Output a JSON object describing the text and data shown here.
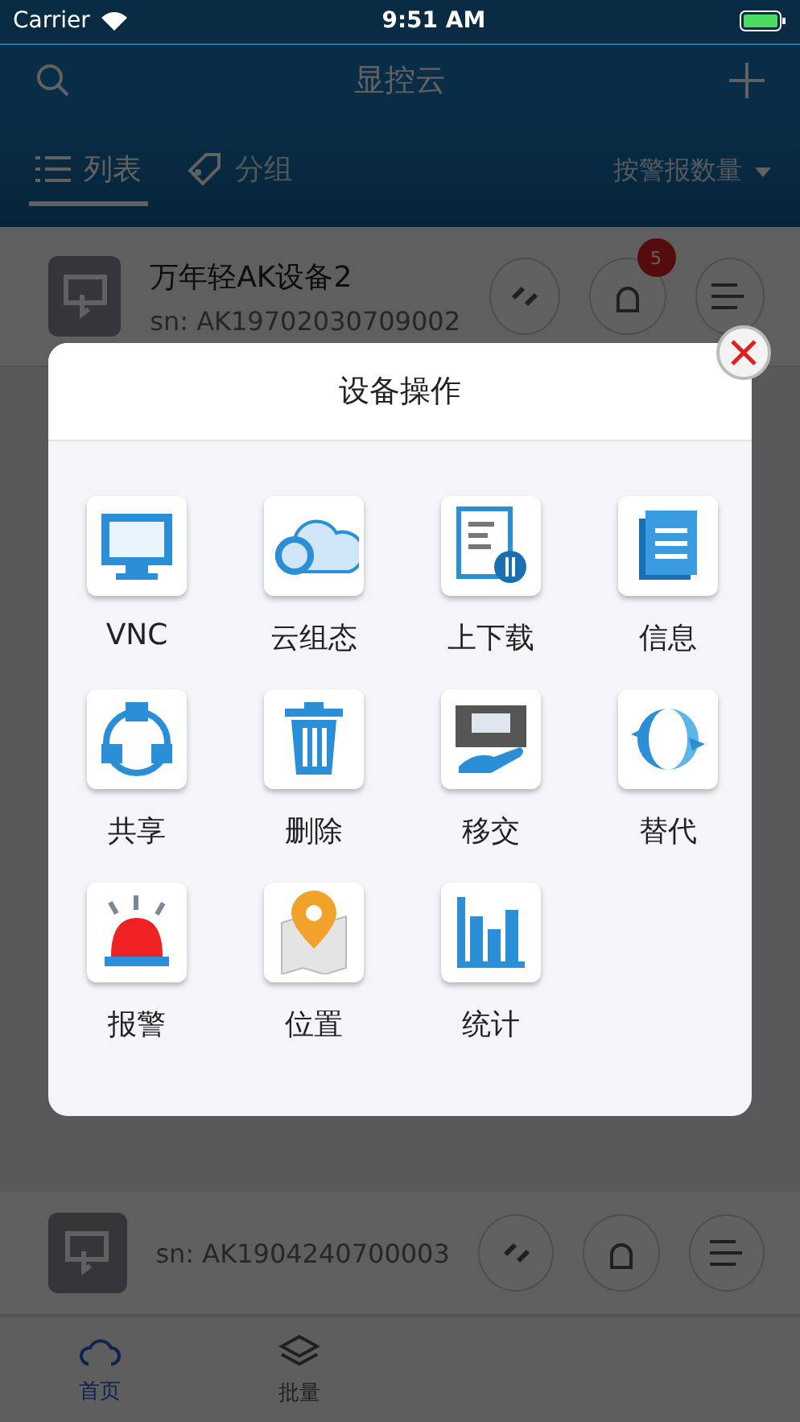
{
  "status_bar": {
    "carrier": "Carrier",
    "time": "9:51 AM"
  },
  "nav": {
    "title": "显控云"
  },
  "view_tabs": [
    {
      "label": "列表",
      "selected": true,
      "kind": "list"
    },
    {
      "label": "分组",
      "selected": false,
      "kind": "group"
    }
  ],
  "sort": {
    "label": "按警报数量"
  },
  "devices": [
    {
      "name": "万年轻AK设备2",
      "sn": "sn: AK19702030709002",
      "alarm_badge": "5"
    },
    {
      "sn": "sn: AK1904240700003"
    }
  ],
  "bottom_tabs": [
    {
      "label": "首页",
      "selected": true,
      "kind": "home"
    },
    {
      "label": "批量",
      "selected": false,
      "kind": "batch"
    }
  ],
  "dialog": {
    "title": "设备操作",
    "actions": [
      {
        "label": "VNC",
        "kind": "vnc"
      },
      {
        "label": "云组态",
        "kind": "cloud"
      },
      {
        "label": "上下载",
        "kind": "transfer"
      },
      {
        "label": "信息",
        "kind": "info"
      },
      {
        "label": "共享",
        "kind": "share"
      },
      {
        "label": "删除",
        "kind": "delete"
      },
      {
        "label": "移交",
        "kind": "handover"
      },
      {
        "label": "替代",
        "kind": "replace"
      },
      {
        "label": "报警",
        "kind": "alarm"
      },
      {
        "label": "位置",
        "kind": "location"
      },
      {
        "label": "统计",
        "kind": "stats"
      }
    ]
  }
}
